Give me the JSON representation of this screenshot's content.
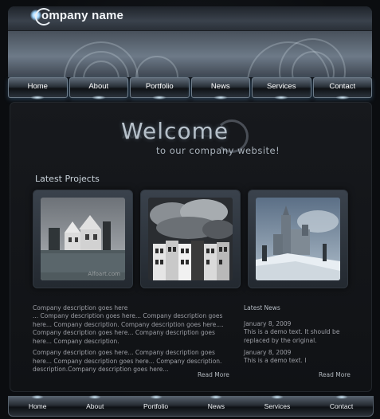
{
  "header": {
    "logo_text": "ompany name"
  },
  "nav": {
    "items": [
      "Home",
      "About",
      "Portfolio",
      "News",
      "Services",
      "Contact"
    ]
  },
  "welcome": {
    "title": "Welcome",
    "subtitle": "to our company website!"
  },
  "projects": {
    "title": "Latest Projects",
    "thumbs": [
      {
        "icon": "house-photo",
        "caption": "Alfoart.com"
      },
      {
        "icon": "townhouses-photo",
        "caption": ""
      },
      {
        "icon": "castle-photo",
        "caption": ""
      }
    ]
  },
  "description": {
    "heading": "Company description goes here",
    "paragraph1": "... Company description goes here... Company description goes here... Company description. Company description goes here.... Company description goes here... Company description goes here... Company description.",
    "paragraph2": "Company description goes here... Company description goes here... Company description goes here... Company description. description.Company description goes here...",
    "read_more": "Read More"
  },
  "news": {
    "title": "Latest News",
    "items": [
      {
        "date": "January 8, 2009",
        "text": "This is a demo text. It should be replaced by the original."
      },
      {
        "date": "January 8, 2009",
        "text": "This is a demo text. I"
      }
    ],
    "read_more": "Read More"
  },
  "footer": {
    "items": [
      "Home",
      "About",
      "Portfolio",
      "News",
      "Services",
      "Contact"
    ]
  },
  "colors": {
    "background": "#0c0e11",
    "accent_glow": "#9fd6ff",
    "text": "#9d9fa6"
  }
}
